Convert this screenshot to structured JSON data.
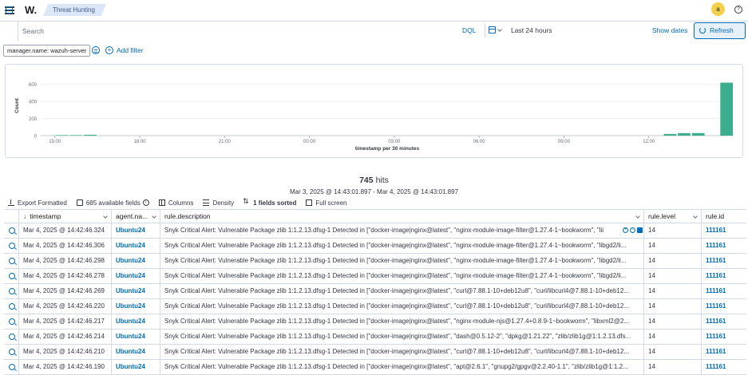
{
  "header": {
    "logo": "W.",
    "breadcrumb": "Threat Hunting",
    "avatar_letter": "a"
  },
  "query": {
    "placeholder": "Search",
    "language": "DQL",
    "time_range": "Last 24 hours",
    "show_dates": "Show dates",
    "refresh": "Refresh"
  },
  "filters": {
    "pills": [
      "manager.name: wazuh-server"
    ],
    "add_filter": "Add filter"
  },
  "chart_data": {
    "type": "bar",
    "xlabel": "timestamp per 30 minutes",
    "ylabel": "Count",
    "ylim": [
      0,
      700
    ],
    "yticks": [
      0,
      200,
      400,
      600
    ],
    "xtick_labels": [
      "15:00",
      "18:00",
      "21:00",
      "00:00",
      "03:00",
      "06:00",
      "09:00",
      "12:00"
    ],
    "bar_color": "#3dae8d",
    "x_start": "14:30",
    "bin_minutes": 30,
    "bins": 49,
    "bars": [
      {
        "bin": 1,
        "value": 6
      },
      {
        "bin": 2,
        "value": 6
      },
      {
        "bin": 3,
        "value": 10
      },
      {
        "bin": 44,
        "value": 20
      },
      {
        "bin": 45,
        "value": 30
      },
      {
        "bin": 46,
        "value": 30
      },
      {
        "bin": 48,
        "value": 620
      }
    ]
  },
  "hits": {
    "count": "745",
    "label": "hits",
    "range": "Mar 3, 2025 @ 14:43:01.897 - Mar 4, 2025 @ 14:43:01.897"
  },
  "toolbar": {
    "export": "Export Formatted",
    "fields": "685 available fields",
    "columns": "Columns",
    "density": "Density",
    "sorted": "1 fields sorted",
    "fullscreen": "Full screen"
  },
  "grid": {
    "columns": {
      "timestamp": "timestamp",
      "agent": "agent.na...",
      "description": "rule.description",
      "level": "rule.level",
      "id": "rule.id"
    },
    "rows": [
      {
        "timestamp": "Mar 4, 2025 @ 14:42:46.324",
        "agent": "Ubuntu24",
        "description": "Snyk Critical Alert: Vulnerable Package zlib 1:1.2.13.dfsg-1 Detected in [\"docker-image|nginx@latest\", \"nginx-module-image-filter@1.27.4-1~bookworm\", \"lii",
        "level": "14",
        "id": "111161"
      },
      {
        "timestamp": "Mar 4, 2025 @ 14:42:46.306",
        "agent": "Ubuntu24",
        "description": "Snyk Critical Alert: Vulnerable Package zlib 1:1.2.13.dfsg-1 Detected in [\"docker-image|nginx@latest\", \"nginx-module-image-filter@1.27.4-1~bookworm\", \"libgd2/li...",
        "level": "14",
        "id": "111161"
      },
      {
        "timestamp": "Mar 4, 2025 @ 14:42:46.298",
        "agent": "Ubuntu24",
        "description": "Snyk Critical Alert: Vulnerable Package zlib 1:1.2.13.dfsg-1 Detected in [\"docker-image|nginx@latest\", \"nginx-module-image-filter@1.27.4-1~bookworm\", \"libgd2/li...",
        "level": "14",
        "id": "111161"
      },
      {
        "timestamp": "Mar 4, 2025 @ 14:42:46.278",
        "agent": "Ubuntu24",
        "description": "Snyk Critical Alert: Vulnerable Package zlib 1:1.2.13.dfsg-1 Detected in [\"docker-image|nginx@latest\", \"nginx-module-image-filter@1.27.4-1~bookworm\", \"libgd2/li...",
        "level": "14",
        "id": "111161"
      },
      {
        "timestamp": "Mar 4, 2025 @ 14:42:46.269",
        "agent": "Ubuntu24",
        "description": "Snyk Critical Alert: Vulnerable Package zlib 1:1.2.13.dfsg-1 Detected in [\"docker-image|nginx@latest\", \"curl@7.88.1-10+deb12u8\", \"curl/libcurl4@7.88.1-10+deb12...",
        "level": "14",
        "id": "111161"
      },
      {
        "timestamp": "Mar 4, 2025 @ 14:42:46.220",
        "agent": "Ubuntu24",
        "description": "Snyk Critical Alert: Vulnerable Package zlib 1:1.2.13.dfsg-1 Detected in [\"docker-image|nginx@latest\", \"curl@7.88.1-10+deb12u8\", \"curl/libcurl4@7.88.1-10+deb12...",
        "level": "14",
        "id": "111161"
      },
      {
        "timestamp": "Mar 4, 2025 @ 14:42:46.217",
        "agent": "Ubuntu24",
        "description": "Snyk Critical Alert: Vulnerable Package zlib 1:1.2.13.dfsg-1 Detected in [\"docker-image|nginx@latest\", \"nginx-module-njs@1.27.4+0.8.9-1~bookworm\", \"libxml2@2...",
        "level": "14",
        "id": "111161"
      },
      {
        "timestamp": "Mar 4, 2025 @ 14:42:46.214",
        "agent": "Ubuntu24",
        "description": "Snyk Critical Alert: Vulnerable Package zlib 1:1.2.13.dfsg-1 Detected in [\"docker-image|nginx@latest\", \"dash@0.5.12-2\", \"dpkg@1.21.22\", \"zlib/zlib1g@1:1.2.13.dfs...",
        "level": "14",
        "id": "111161"
      },
      {
        "timestamp": "Mar 4, 2025 @ 14:42:46.210",
        "agent": "Ubuntu24",
        "description": "Snyk Critical Alert: Vulnerable Package zlib 1:1.2.13.dfsg-1 Detected in [\"docker-image|nginx@latest\", \"curl@7.88.1-10+deb12u8\", \"curl/libcurl4@7.88.1-10+deb12...",
        "level": "14",
        "id": "111161"
      },
      {
        "timestamp": "Mar 4, 2025 @ 14:42:46.190",
        "agent": "Ubuntu24",
        "description": "Snyk Critical Alert: Vulnerable Package zlib 1:1.2.13.dfsg-1 Detected in [\"docker-image|nginx@latest\", \"apt@2.6.1\", \"gnupg2/gpgv@2.2.40-1.1\", \"zlib/zlib1g@1:1.2...",
        "level": "14",
        "id": "111161"
      }
    ]
  }
}
